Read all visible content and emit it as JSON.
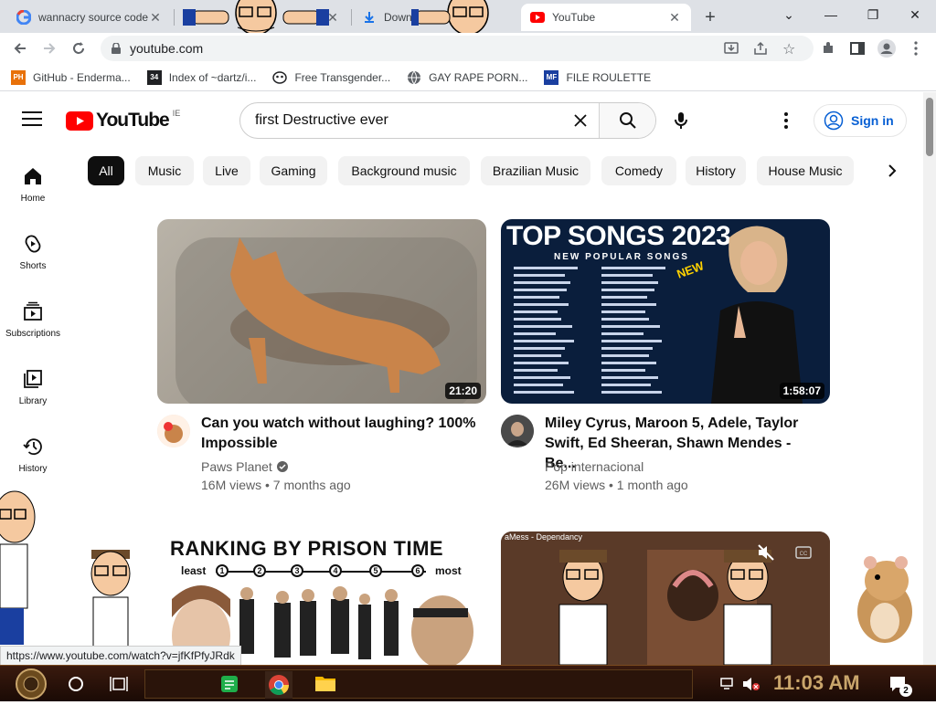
{
  "browser": {
    "tabs": [
      {
        "title": "wannacry source code",
        "icon": "google-g-icon"
      },
      {
        "title": "",
        "icon": "page-icon"
      },
      {
        "title": "Downl",
        "icon": "download-icon"
      },
      {
        "title": "YouTube",
        "icon": "youtube-icon"
      }
    ],
    "url": "youtube.com",
    "bookmarks": [
      {
        "label": "GitHub - Enderma...",
        "icon": "PH"
      },
      {
        "label": "Index of ~dartz/i...",
        "icon": "34"
      },
      {
        "label": "Free Transgender...",
        "icon": "mask"
      },
      {
        "label": "GAY RAPE PORN...",
        "icon": "globe"
      },
      {
        "label": "FILE ROULETTE",
        "icon": "MF"
      }
    ],
    "status_url": "https://www.youtube.com/watch?v=jfKfPfyJRdk"
  },
  "youtube": {
    "logo_text": "YouTube",
    "region": "IE",
    "search_value": "first Destructive ever",
    "signin_label": "Sign in",
    "chips": [
      "All",
      "Music",
      "Live",
      "Gaming",
      "Background music",
      "Brazilian Music",
      "Comedy",
      "History",
      "House Music"
    ],
    "nav": [
      {
        "label": "Home"
      },
      {
        "label": "Shorts"
      },
      {
        "label": "Subscriptions"
      },
      {
        "label": "Library"
      },
      {
        "label": "History"
      }
    ],
    "videos": [
      {
        "title_line1": "Can you watch without laughing? 100%",
        "title_line2": "Impossible",
        "channel": "Paws Planet",
        "meta": "16M views • 7 months ago",
        "duration": "21:20"
      },
      {
        "title_line1": "Miley Cyrus, Maroon 5, Adele, Taylor",
        "title_line2": "Swift, Ed Sheeran, Shawn Mendes - Be...",
        "channel": "Pop internacional",
        "meta": "26M views • 1 month ago",
        "duration": "1:58:07",
        "thumb_heading": "TOP SONGS 2023",
        "thumb_subheading": "NEW POPULAR SONGS",
        "thumb_badge": "NEW"
      },
      {
        "thumb_heading": "RANKING BY PRISON TIME",
        "scale_left": "least",
        "scale_right": "most",
        "scale_numbers": [
          "1",
          "2",
          "3",
          "4",
          "5",
          "6"
        ]
      },
      {
        "thumb_caption": "aMess - Dependancy"
      }
    ]
  },
  "taskbar": {
    "clock": "11:03 AM",
    "notifications": "2"
  },
  "colors": {
    "youtube_red": "#ff0000",
    "signin_blue": "#065fd4",
    "chip_bg": "#f2f2f2"
  }
}
